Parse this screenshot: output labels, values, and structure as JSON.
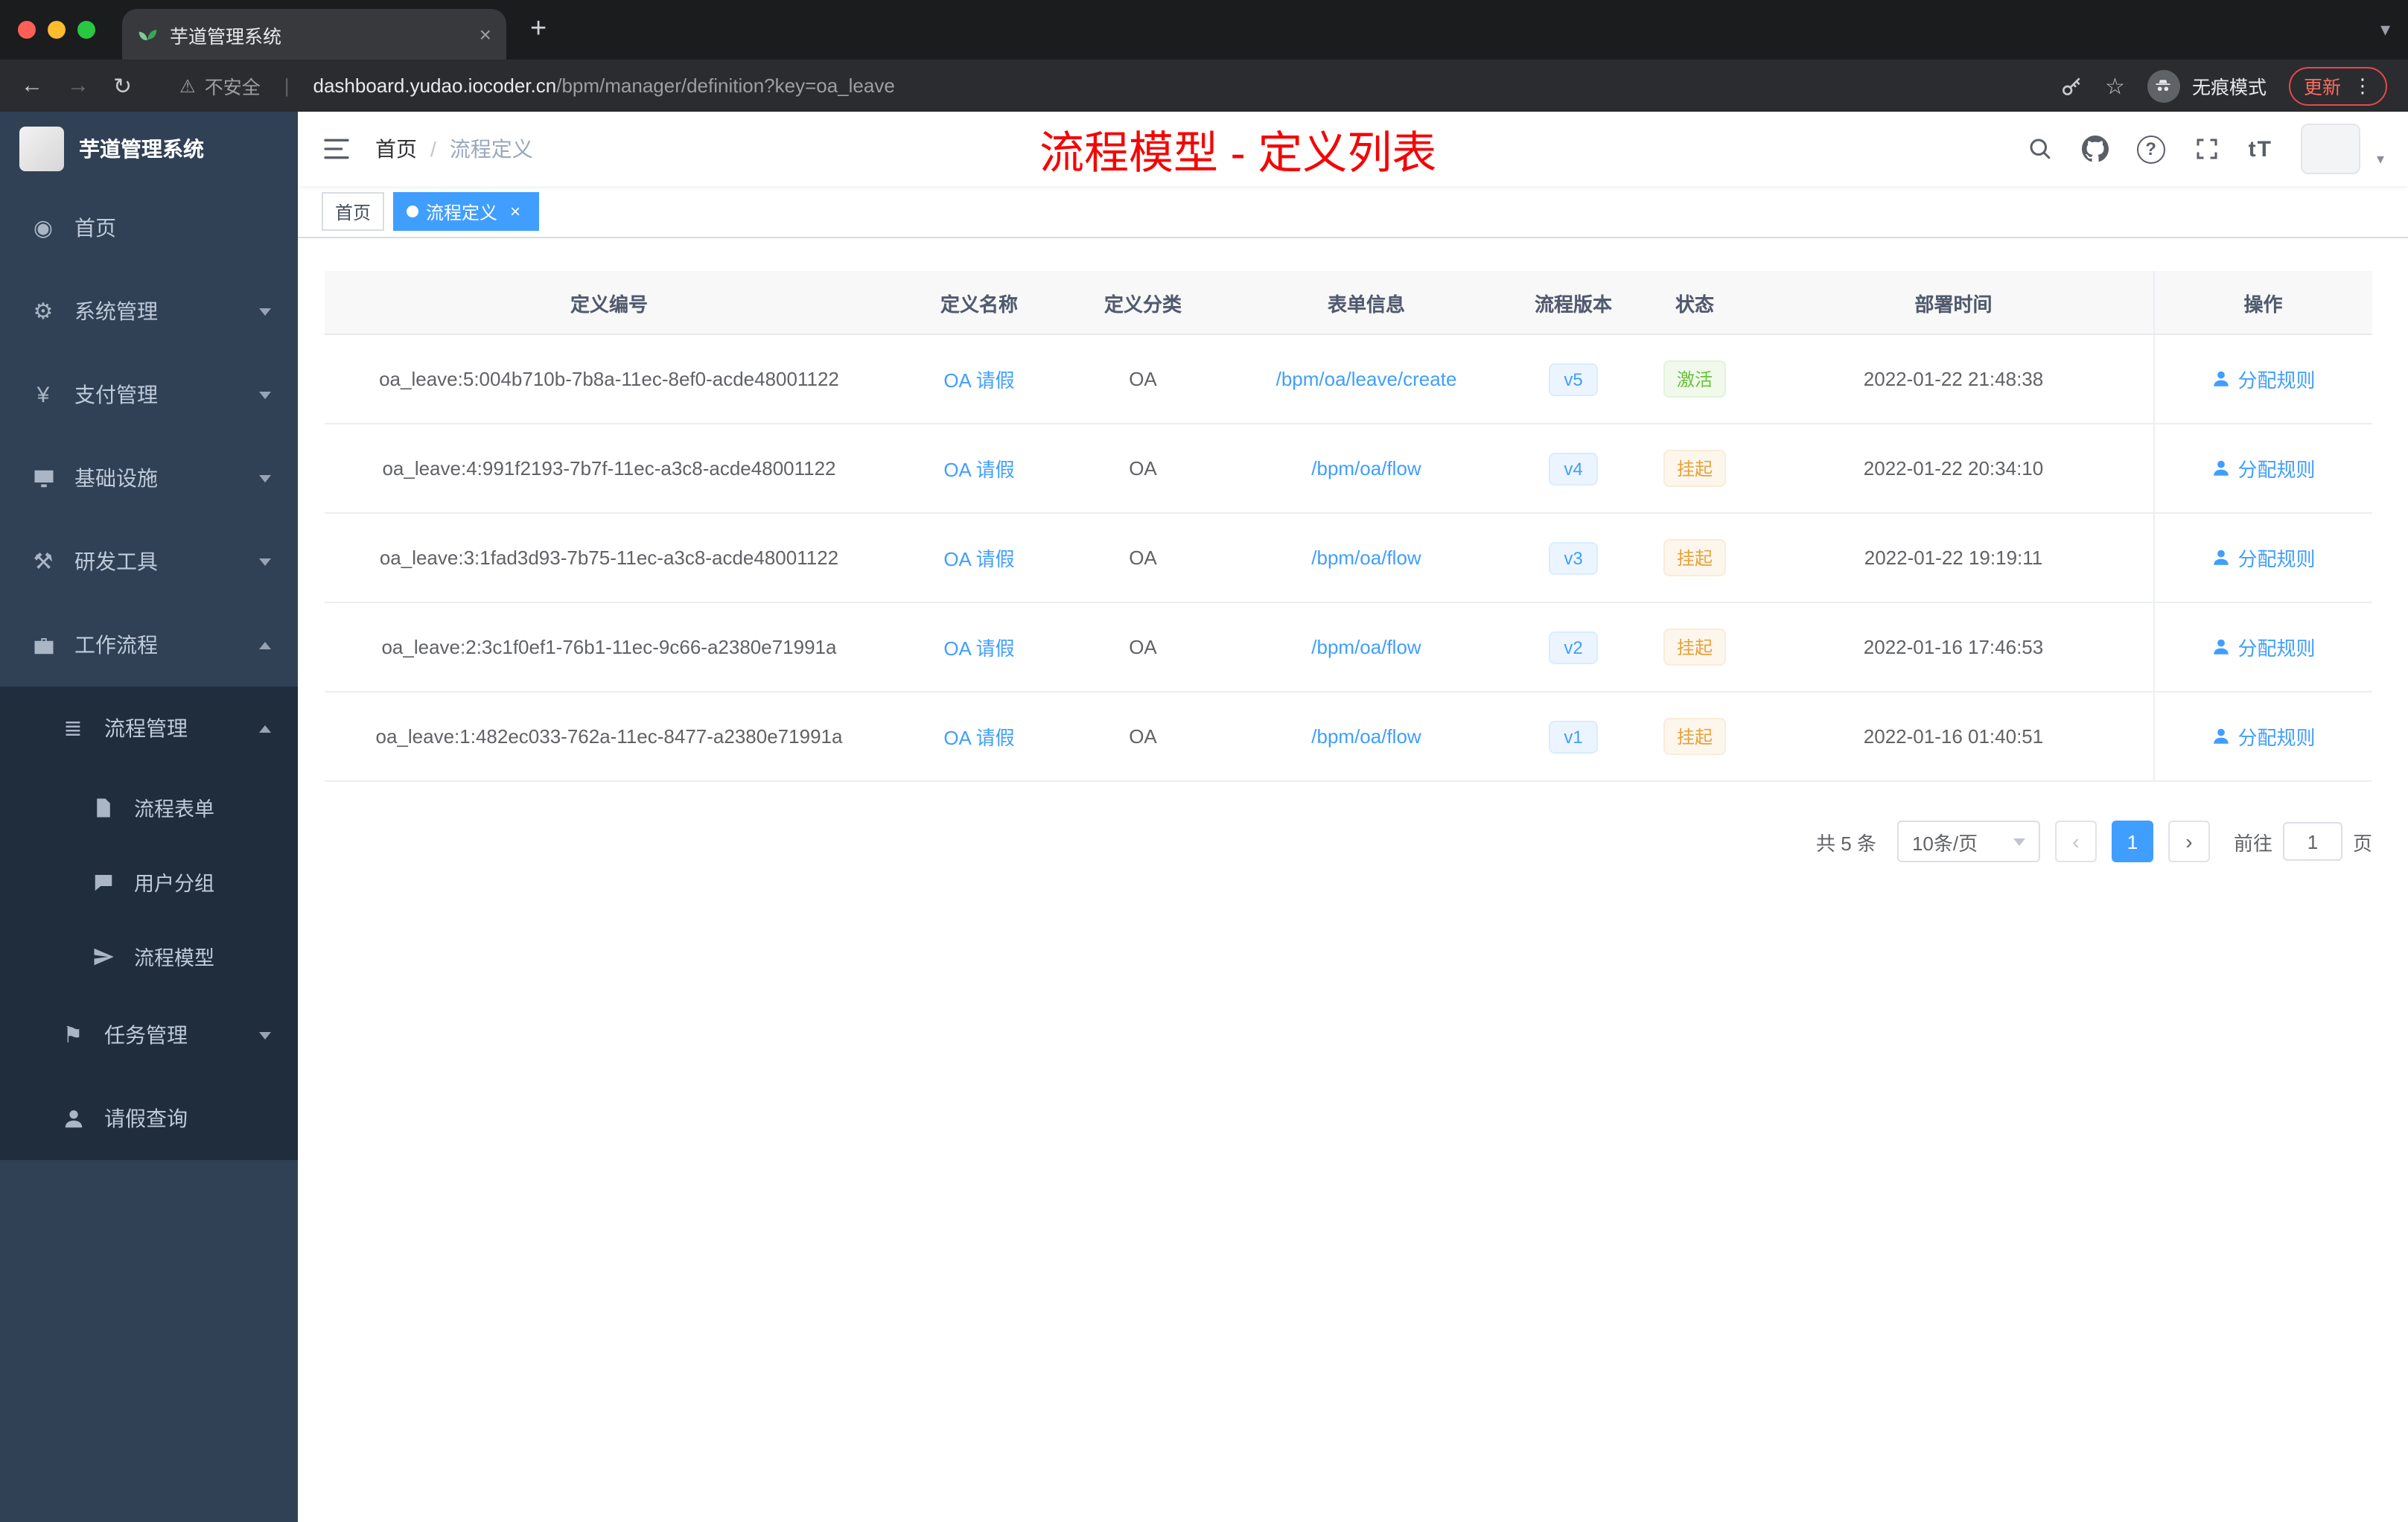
{
  "browser": {
    "tab_title": "芋道管理系统",
    "security_label": "不安全",
    "url_host": "dashboard.yudao.iocoder.cn",
    "url_path": "/bpm/manager/definition?key=oa_leave",
    "incognito_label": "无痕模式",
    "update_label": "更新"
  },
  "icons": {
    "back": "←",
    "forward": "→",
    "reload": "↻",
    "warning": "⚠",
    "divider": "|",
    "star": "☆",
    "menu_dots": "⋮",
    "close": "×",
    "new_tab": "+",
    "prev": "‹",
    "next": "›",
    "caret": "▾",
    "question": "?",
    "home": "◉",
    "gear": "⚙",
    "yen": "¥",
    "tools": "⚒",
    "list": "≣",
    "flag": "⚑"
  },
  "sidebar": {
    "logo_title": "芋道管理系统",
    "items": [
      {
        "label": "首页",
        "icon": "home-icon"
      },
      {
        "label": "系统管理",
        "icon": "gear-icon"
      },
      {
        "label": "支付管理",
        "icon": "yen-icon"
      },
      {
        "label": "基础设施",
        "icon": "monitor-icon"
      },
      {
        "label": "研发工具",
        "icon": "tools-icon"
      },
      {
        "label": "工作流程",
        "icon": "briefcase-icon"
      },
      {
        "label": "流程管理",
        "icon": "list-icon"
      },
      {
        "label": "流程表单",
        "icon": "document-icon"
      },
      {
        "label": "用户分组",
        "icon": "chat-icon"
      },
      {
        "label": "流程模型",
        "icon": "paper-plane-icon"
      },
      {
        "label": "任务管理",
        "icon": "flag-icon"
      },
      {
        "label": "请假查询",
        "icon": "person-icon"
      }
    ]
  },
  "header": {
    "breadcrumb_home": "首页",
    "breadcrumb_sep": "/",
    "breadcrumb_current": "流程定义",
    "annotation": "流程模型 - 定义列表",
    "font_size_icon": "tT"
  },
  "tags": {
    "home": "首页",
    "active": "流程定义"
  },
  "table": {
    "columns": [
      "定义编号",
      "定义名称",
      "定义分类",
      "表单信息",
      "流程版本",
      "状态",
      "部署时间",
      "操作"
    ],
    "rows": [
      {
        "id": "oa_leave:5:004b710b-7b8a-11ec-8ef0-acde48001122",
        "name": "OA 请假",
        "category": "OA",
        "form": "/bpm/oa/leave/create",
        "version": "v5",
        "status": "激活",
        "time": "2022-01-22 21:48:38",
        "action": "分配规则"
      },
      {
        "id": "oa_leave:4:991f2193-7b7f-11ec-a3c8-acde48001122",
        "name": "OA 请假",
        "category": "OA",
        "form": "/bpm/oa/flow",
        "version": "v4",
        "status": "挂起",
        "time": "2022-01-22 20:34:10",
        "action": "分配规则"
      },
      {
        "id": "oa_leave:3:1fad3d93-7b75-11ec-a3c8-acde48001122",
        "name": "OA 请假",
        "category": "OA",
        "form": "/bpm/oa/flow",
        "version": "v3",
        "status": "挂起",
        "time": "2022-01-22 19:19:11",
        "action": "分配规则"
      },
      {
        "id": "oa_leave:2:3c1f0ef1-76b1-11ec-9c66-a2380e71991a",
        "name": "OA 请假",
        "category": "OA",
        "form": "/bpm/oa/flow",
        "version": "v2",
        "status": "挂起",
        "time": "2022-01-16 17:46:53",
        "action": "分配规则"
      },
      {
        "id": "oa_leave:1:482ec033-762a-11ec-8477-a2380e71991a",
        "name": "OA 请假",
        "category": "OA",
        "form": "/bpm/oa/flow",
        "version": "v1",
        "status": "挂起",
        "time": "2022-01-16 01:40:51",
        "action": "分配规则"
      }
    ]
  },
  "pagination": {
    "total": "共 5 条",
    "page_size": "10条/页",
    "current": "1",
    "goto_prefix": "前往",
    "goto_value": "1",
    "goto_suffix": "页"
  },
  "colors": {
    "accent": "#409eff",
    "sidebar_bg": "#304156",
    "submenu_bg": "#1f2d3d",
    "success": "#67c23a",
    "warning": "#e6a23c",
    "annotation_red": "#f40606"
  }
}
